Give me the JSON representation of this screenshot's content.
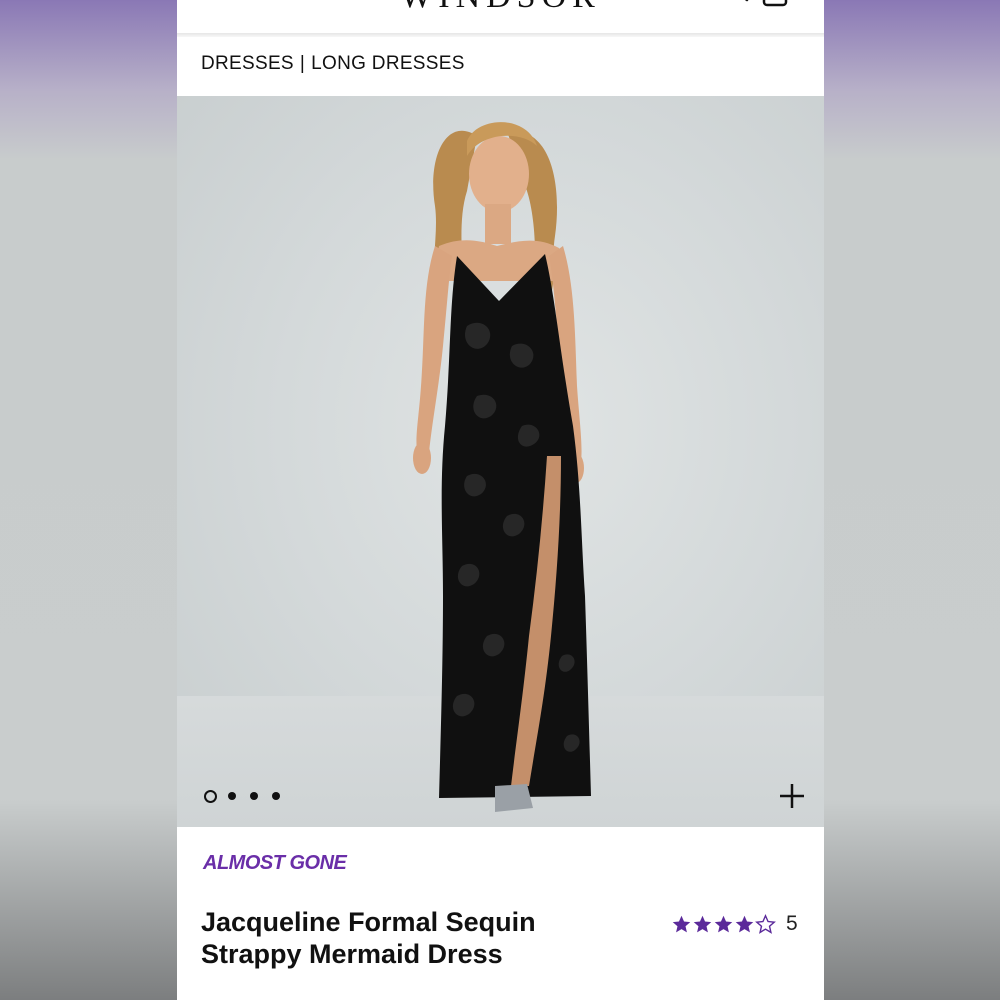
{
  "header": {
    "brand": "WINDSOR",
    "menu_icon": "hamburger-menu-icon",
    "search_icon": "search-icon",
    "bag_icon": "shopping-bag-icon"
  },
  "breadcrumb": {
    "items": [
      "DRESSES",
      "LONG DRESSES"
    ],
    "separator": "|"
  },
  "gallery": {
    "image": "model in black sequin strappy mermaid dress",
    "page_count": 4,
    "active_index": 0,
    "zoom_icon": "plus-icon"
  },
  "product": {
    "badge": "ALMOST GONE",
    "title_line1": "Jacqueline Formal Sequin",
    "title_line2": "Strappy Mermaid Dress",
    "rating": 4,
    "rating_max": 5,
    "review_count": "5"
  },
  "colors": {
    "accent_purple": "#6a2ea8",
    "star_purple": "#5b2a9a",
    "text": "#111111"
  }
}
